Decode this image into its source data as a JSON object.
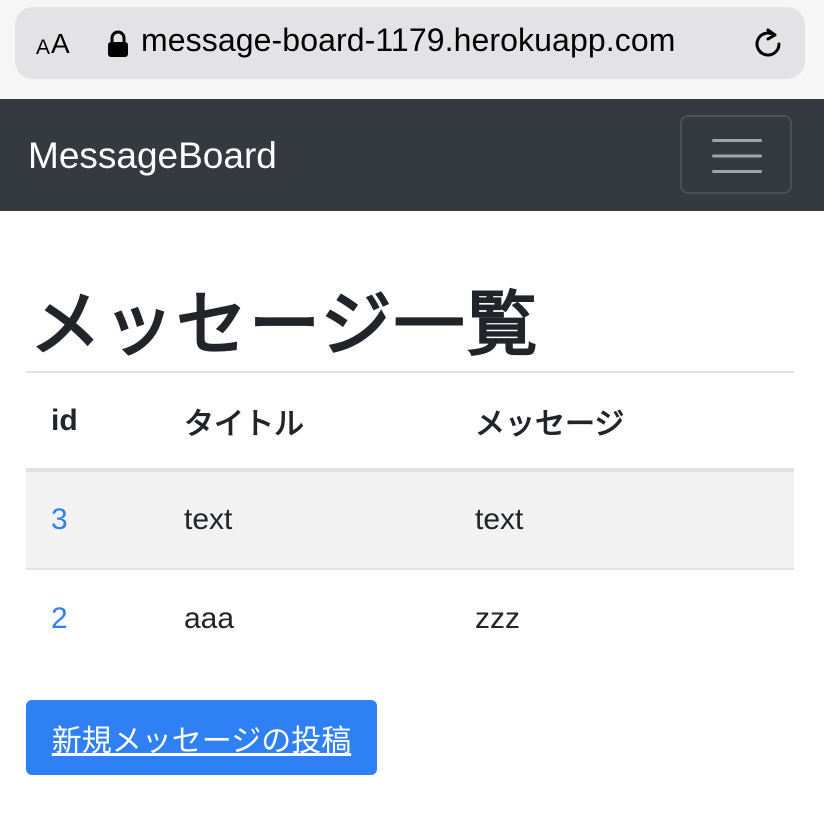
{
  "browser": {
    "text_size_small": "A",
    "text_size_large": "A",
    "url": "message-board-1179.herokuapp.com"
  },
  "navbar": {
    "brand": "MessageBoard"
  },
  "main": {
    "title": "メッセージ一覧",
    "table": {
      "headers": [
        "id",
        "タイトル",
        "メッセージ"
      ],
      "rows": [
        {
          "id": "3",
          "title": "text",
          "message": "text"
        },
        {
          "id": "2",
          "title": "aaa",
          "message": "zzz"
        }
      ]
    },
    "new_button_label": "新規メッセージの投稿"
  },
  "colors": {
    "navbar_bg": "#343a40",
    "link": "#2f7ff5",
    "button_bg": "#2f7ff5",
    "stripe": "#f2f2f2"
  }
}
